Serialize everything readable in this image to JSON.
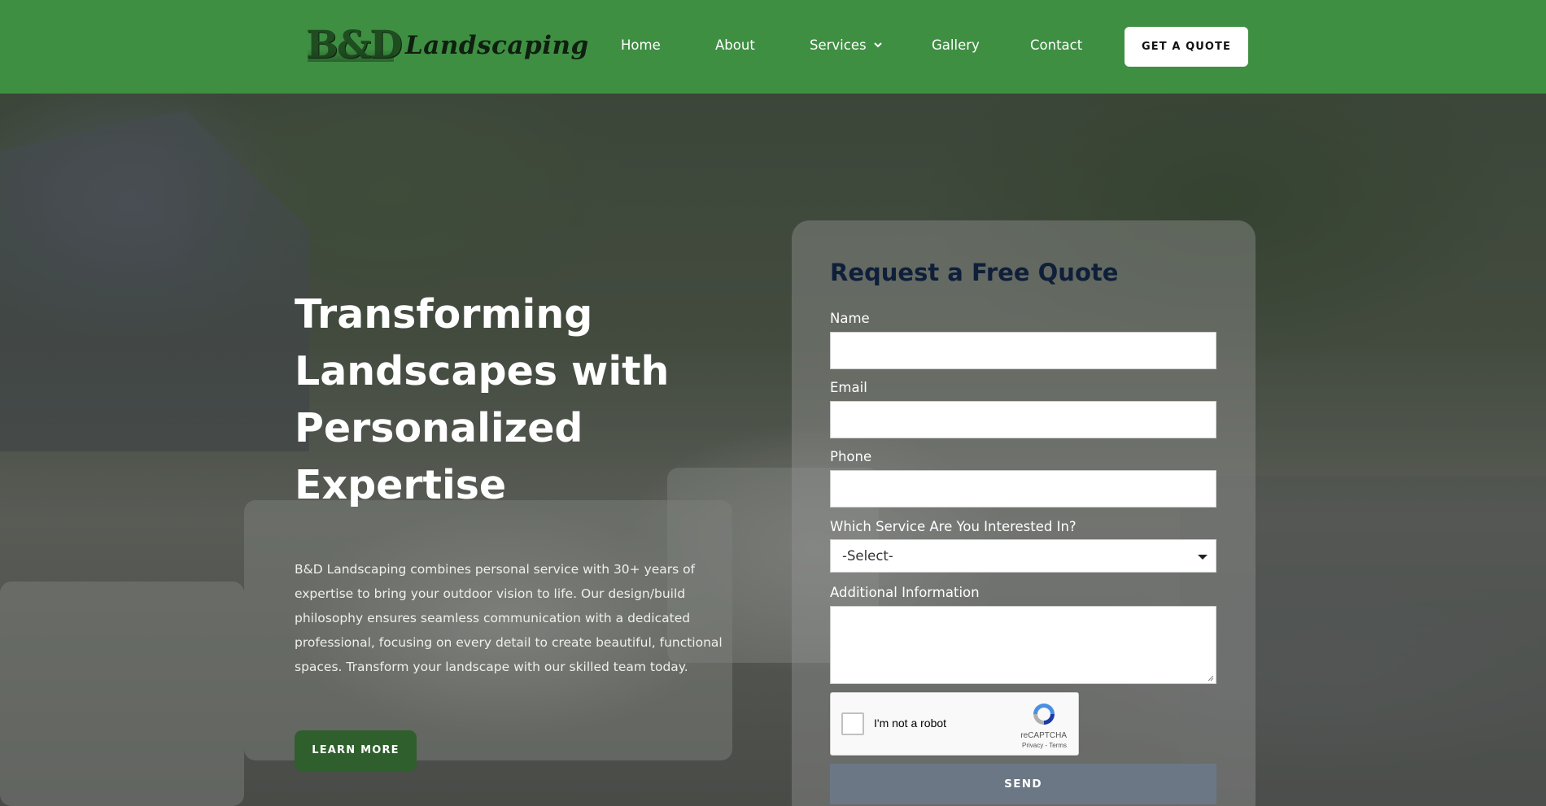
{
  "header": {
    "logo": {
      "monogram": "B&D",
      "wordmark": "Landscaping"
    },
    "nav": [
      {
        "label": "Home"
      },
      {
        "label": "About"
      },
      {
        "label": "Services",
        "icon": "chevron-down-icon"
      },
      {
        "label": "Gallery"
      },
      {
        "label": "Contact"
      }
    ],
    "cta_label": "GET A QUOTE"
  },
  "hero": {
    "title": "Transforming Landscapes with Personalized Expertise",
    "description": "B&D Landscaping combines personal service with 30+ years of expertise to bring your outdoor vision to life. Our design/build philosophy ensures seamless communication with a dedicated professional, focusing on every detail to create beautiful, functional spaces. Transform your landscape with our skilled team today.",
    "button_label": "LEARN MORE"
  },
  "form": {
    "title": "Request a Free Quote",
    "name_label": "Name",
    "email_label": "Email",
    "phone_label": "Phone",
    "service_label": "Which Service Are You Interested In?",
    "service_selected": "-Select-",
    "info_label": "Additional Information",
    "captcha": {
      "label": "I'm not a robot",
      "brand": "reCAPTCHA",
      "links": "Privacy - Terms"
    },
    "send_label": "SEND"
  },
  "colors": {
    "header_bg": "#3f8f43",
    "hero_button": "#2f5f2c",
    "form_title": "#0f1f3a",
    "send_button": "#6b7784"
  }
}
